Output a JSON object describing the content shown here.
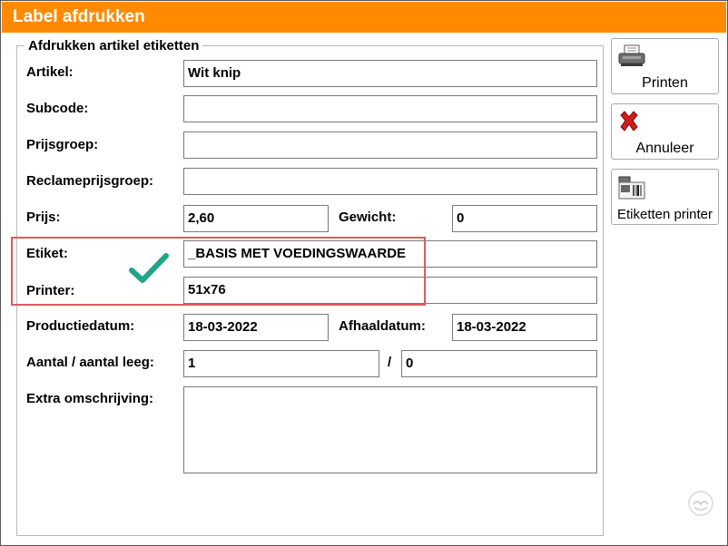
{
  "window": {
    "title": "Label afdrukken"
  },
  "section": {
    "legend": "Afdrukken artikel etiketten"
  },
  "form": {
    "artikel": {
      "label": "Artikel:",
      "value": "Wit knip"
    },
    "subcode": {
      "label": "Subcode:",
      "value": ""
    },
    "prijsgroep": {
      "label": "Prijsgroep:",
      "value": ""
    },
    "reclame": {
      "label": "Reclameprijsgroep:",
      "value": ""
    },
    "prijs": {
      "label": "Prijs:",
      "value": "2,60"
    },
    "gewicht": {
      "label": "Gewicht:",
      "value": "0"
    },
    "etiket": {
      "label": "Etiket:",
      "value": "_BASIS MET VOEDINGSWAARDE"
    },
    "printer": {
      "label": "Printer:",
      "value": "51x76"
    },
    "productiedatum": {
      "label": "Productiedatum:",
      "value": "18-03-2022"
    },
    "afhaaldatum": {
      "label": "Afhaaldatum:",
      "value": "18-03-2022"
    },
    "aantal": {
      "label": "Aantal / aantal leeg:",
      "value": "1",
      "separator": "/",
      "leeg_value": "0"
    },
    "extra": {
      "label": "Extra omschrijving:",
      "value": ""
    }
  },
  "buttons": {
    "printen": "Printen",
    "annuleer": "Annuleer",
    "etiketten_printer": "Etiketten printer"
  },
  "colors": {
    "titlebar": "#ff8a00",
    "highlight": "#e05a5a",
    "check": "#1fa58a"
  },
  "icons": [
    "printer-icon",
    "cancel-x-icon",
    "label-printer-icon",
    "check-icon",
    "logo-icon"
  ]
}
